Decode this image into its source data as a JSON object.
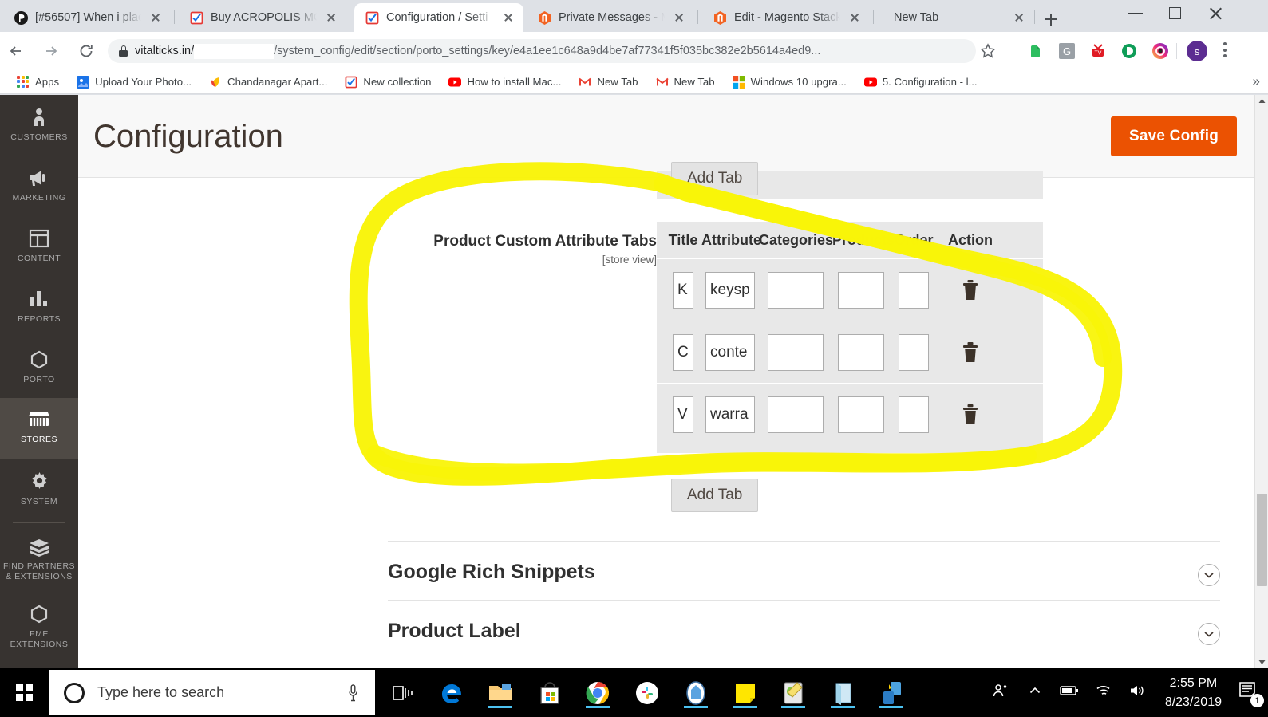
{
  "browser": {
    "tabs": [
      {
        "title": "[#56507] When i plac",
        "favicon": "pagerduty-icon",
        "active": false,
        "has_close": true
      },
      {
        "title": "Buy ACROPOLIS MO",
        "favicon": "checkbox-icon",
        "active": false,
        "has_close": true
      },
      {
        "title": "Configuration / Setti",
        "favicon": "checkbox-icon",
        "active": true,
        "has_close": true
      },
      {
        "title": "Private Messages - M",
        "favicon": "magento-icon",
        "active": false,
        "has_close": true
      },
      {
        "title": "Edit - Magento Stack",
        "favicon": "magento-icon",
        "active": false,
        "has_close": true
      },
      {
        "title": "New Tab",
        "favicon": "",
        "active": false,
        "has_close": true
      }
    ],
    "new_tab_button": "new-tab-button",
    "window_controls": {
      "minimize": "minimize-button",
      "maximize": "maximize-button",
      "close": "close-button"
    },
    "omnibox": {
      "host": "vitalticks.in/",
      "path": "/system_config/edit/section/porto_settings/key/e4a1ee1c648a9d4be7af77341f5f035bc382e2b5614a4ed9...",
      "secure": true
    },
    "extensions": [
      {
        "name": "evernote-extension-icon",
        "color": "#2dbe60",
        "letter": ""
      },
      {
        "name": "grammarly-extension-icon",
        "color": "#9aa0a6",
        "letter": "G"
      },
      {
        "name": "tv-extension-icon",
        "color": "#e01b24",
        "letter": ""
      },
      {
        "name": "pocket-extension-icon",
        "color": "#0f9d58",
        "letter": "D"
      },
      {
        "name": "instagram-extension-icon",
        "color": "#c13584",
        "letter": ""
      }
    ],
    "profile": {
      "name": "profile-avatar",
      "letter": "s",
      "color": "#5c2d91"
    },
    "bookmarks": [
      {
        "label": "Apps",
        "icon": "apps-grid-icon"
      },
      {
        "label": "Upload Your Photo...",
        "icon": "photo-icon"
      },
      {
        "label": "Chandanagar Apart...",
        "icon": "leaf-icon"
      },
      {
        "label": "New collection",
        "icon": "checkbox-icon"
      },
      {
        "label": "How to install Mac...",
        "icon": "youtube-icon"
      },
      {
        "label": "New Tab",
        "icon": "gmail-icon"
      },
      {
        "label": "New Tab",
        "icon": "gmail-icon"
      },
      {
        "label": "Windows 10 upgra...",
        "icon": "windows-icon"
      },
      {
        "label": "5. Configuration - l...",
        "icon": "youtube-icon"
      }
    ],
    "bookmarks_overflow": "»"
  },
  "admin": {
    "sidebar": [
      {
        "label": "CUSTOMERS",
        "icon": "customers-icon",
        "active": false
      },
      {
        "label": "MARKETING",
        "icon": "megaphone-icon",
        "active": false
      },
      {
        "label": "CONTENT",
        "icon": "layout-icon",
        "active": false
      },
      {
        "label": "REPORTS",
        "icon": "bar-chart-icon",
        "active": false
      },
      {
        "label": "PORTO",
        "icon": "hexagon-icon",
        "active": false
      },
      {
        "label": "STORES",
        "icon": "storefront-icon",
        "active": true
      },
      {
        "label": "SYSTEM",
        "icon": "gear-icon",
        "active": false
      },
      {
        "label": "FIND PARTNERS\n& EXTENSIONS",
        "icon": "box-icon",
        "active": false
      },
      {
        "label": "FME\nEXTENSIONS",
        "icon": "hexagon-icon",
        "active": false
      }
    ],
    "page_title": "Configuration",
    "save_button": "Save Config",
    "save_button_color": "#eb5202",
    "add_tab_top": "Add Tab",
    "add_tab_bottom": "Add Tab",
    "field": {
      "label": "Product Custom Attribute Tabs",
      "scope": "[store view]"
    },
    "table": {
      "headers": [
        "Title",
        "Attribute",
        "Categories",
        "Products",
        "Order",
        "Action"
      ],
      "rows": [
        {
          "title": "K",
          "attribute": "keysp",
          "categories": "",
          "products": "",
          "order": "",
          "action": "trash-icon"
        },
        {
          "title": "C",
          "attribute": "conte",
          "categories": "",
          "products": "",
          "order": "",
          "action": "trash-icon"
        },
        {
          "title": "V",
          "attribute": "warra",
          "categories": "",
          "products": "",
          "order": "",
          "action": "trash-icon"
        }
      ]
    },
    "sections": [
      {
        "label": "Google Rich Snippets",
        "expanded": false
      },
      {
        "label": "Product Label",
        "expanded": false
      }
    ]
  },
  "taskbar": {
    "search_placeholder": "Type here to search",
    "time": "2:55 PM",
    "date": "8/23/2019",
    "notification_count": "1",
    "apps": [
      {
        "name": "task-view-icon",
        "running": false
      },
      {
        "name": "edge-icon",
        "running": false
      },
      {
        "name": "file-explorer-icon",
        "running": true
      },
      {
        "name": "microsoft-store-icon",
        "running": false
      },
      {
        "name": "chrome-icon",
        "running": true
      },
      {
        "name": "slack-icon",
        "running": false
      },
      {
        "name": "evernote-icon",
        "running": true
      },
      {
        "name": "sticky-notes-icon",
        "running": true
      },
      {
        "name": "paint-icon",
        "running": true
      },
      {
        "name": "onenote-icon",
        "running": true
      },
      {
        "name": "your-phone-icon",
        "running": true
      }
    ],
    "tray": [
      {
        "name": "people-icon"
      },
      {
        "name": "show-hidden-icons-icon"
      },
      {
        "name": "battery-icon"
      },
      {
        "name": "wifi-icon"
      },
      {
        "name": "volume-icon"
      }
    ]
  }
}
